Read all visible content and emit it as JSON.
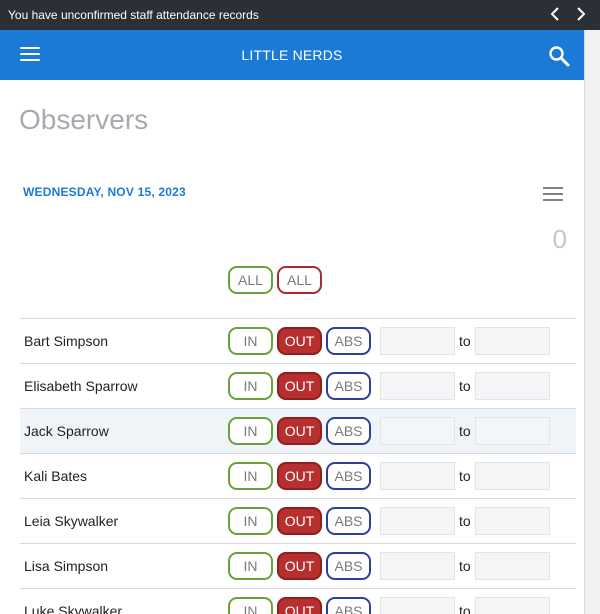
{
  "notice": {
    "text": "You have unconfirmed staff attendance records"
  },
  "appbar": {
    "title": "LITTLE NERDS"
  },
  "page": {
    "title": "Observers",
    "date": "WEDNESDAY, NOV 15, 2023",
    "count": "0"
  },
  "bulk": {
    "all_in_label": "ALL",
    "all_out_label": "ALL"
  },
  "labels": {
    "in": "IN",
    "out": "OUT",
    "abs": "ABS",
    "to": "to"
  },
  "people": [
    {
      "name": "Bart Simpson"
    },
    {
      "name": "Elisabeth Sparrow"
    },
    {
      "name": "Jack Sparrow"
    },
    {
      "name": "Kali Bates"
    },
    {
      "name": "Leia Skywalker"
    },
    {
      "name": "Lisa Simpson"
    },
    {
      "name": "Luke Skywalker"
    }
  ],
  "colors": {
    "primary": "#1a7ad6",
    "notice_bg": "#2b2f36",
    "in_border": "#6aa13a",
    "out_fill": "#b72f2f",
    "abs_border": "#2f3f9a"
  },
  "icons": {
    "menu": "hamburger-icon",
    "search": "search-icon",
    "prev": "chevron-left-icon",
    "next": "chevron-right-icon",
    "list_menu": "hamburger-icon"
  }
}
